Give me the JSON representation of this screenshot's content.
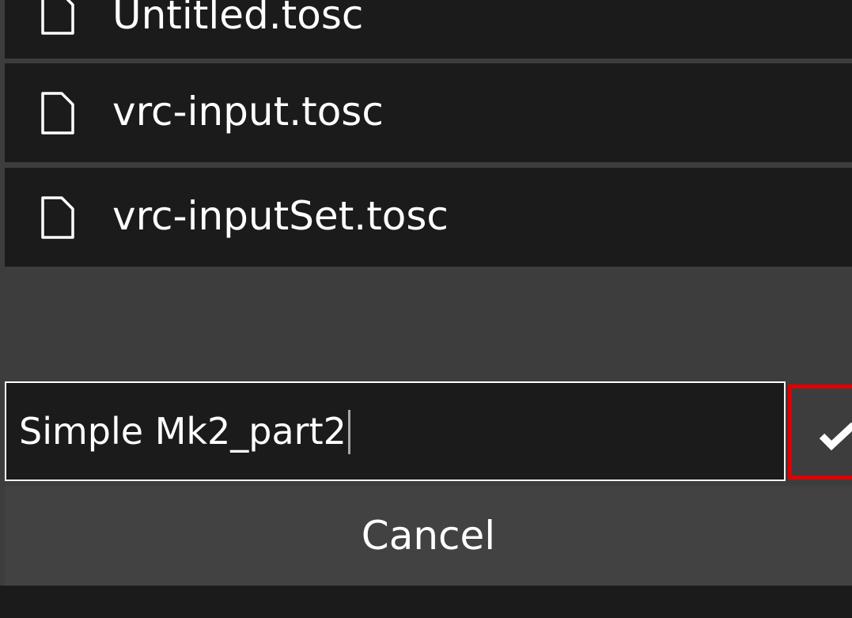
{
  "file_list": {
    "items": [
      {
        "name": "Untitled.tosc",
        "icon": "file-icon"
      },
      {
        "name": "vrc-input.tosc",
        "icon": "file-icon"
      },
      {
        "name": "vrc-inputSet.tosc",
        "icon": "file-icon"
      }
    ]
  },
  "save_dialog": {
    "filename_value": "Simple Mk2_part2",
    "confirm_icon": "checkmark-icon",
    "cancel_label": "Cancel"
  },
  "colors": {
    "background": "#1b1b1b",
    "dialog_background": "#3d3d3d",
    "text": "#ffffff",
    "highlight": "#e00000"
  }
}
